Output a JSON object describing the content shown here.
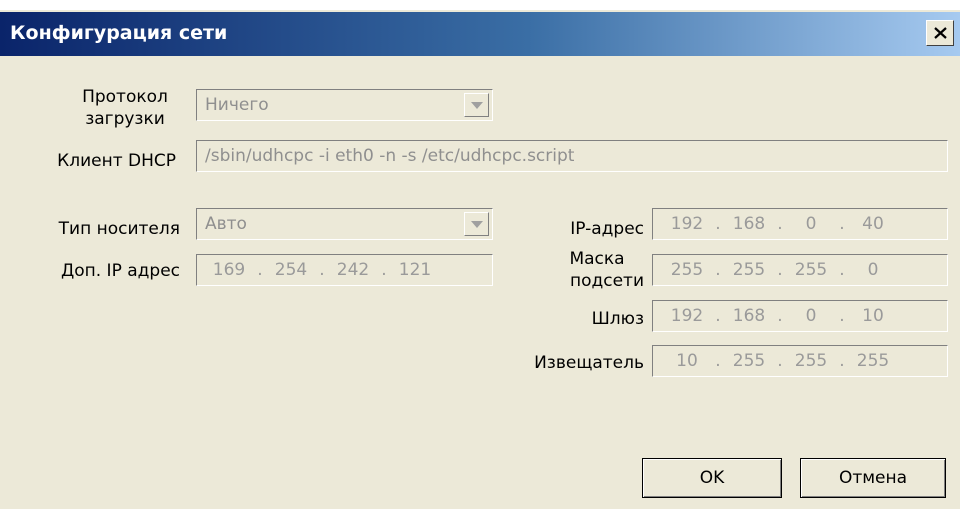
{
  "window": {
    "title": "Конфигурация сети",
    "close_label": "×"
  },
  "boot_protocol": {
    "label_line1": "Протокол",
    "label_line2": "загрузки",
    "value": "Ничего"
  },
  "dhcp_client": {
    "label": "Клиент DHCP",
    "value": "/sbin/udhcpc -i eth0 -n -s /etc/udhcpc.script"
  },
  "media_type": {
    "label": "Тип носителя",
    "value": "Авто"
  },
  "extra_ip": {
    "label": "Доп. IP адрес",
    "octets": [
      "169",
      "254",
      "242",
      "121"
    ]
  },
  "ip_address": {
    "label": "IP-адрес",
    "octets": [
      "192",
      "168",
      "0",
      "40"
    ]
  },
  "subnet_mask": {
    "label_line1": "Маска",
    "label_line2": "подсети",
    "octets": [
      "255",
      "255",
      "255",
      "0"
    ]
  },
  "gateway": {
    "label": "Шлюз",
    "octets": [
      "192",
      "168",
      "0",
      "10"
    ]
  },
  "broadcast": {
    "label": "Извещатель",
    "octets": [
      "10",
      "255",
      "255",
      "255"
    ]
  },
  "buttons": {
    "ok": "OK",
    "cancel": "Отмена"
  },
  "colors": {
    "titlebar_start": "#0a246a",
    "titlebar_end": "#a6caf0",
    "dialog_bg": "#ece9d8",
    "disabled_text": "#8f8f8f"
  },
  "icons": {
    "close": "close-icon",
    "dropdown": "chevron-down-icon"
  }
}
